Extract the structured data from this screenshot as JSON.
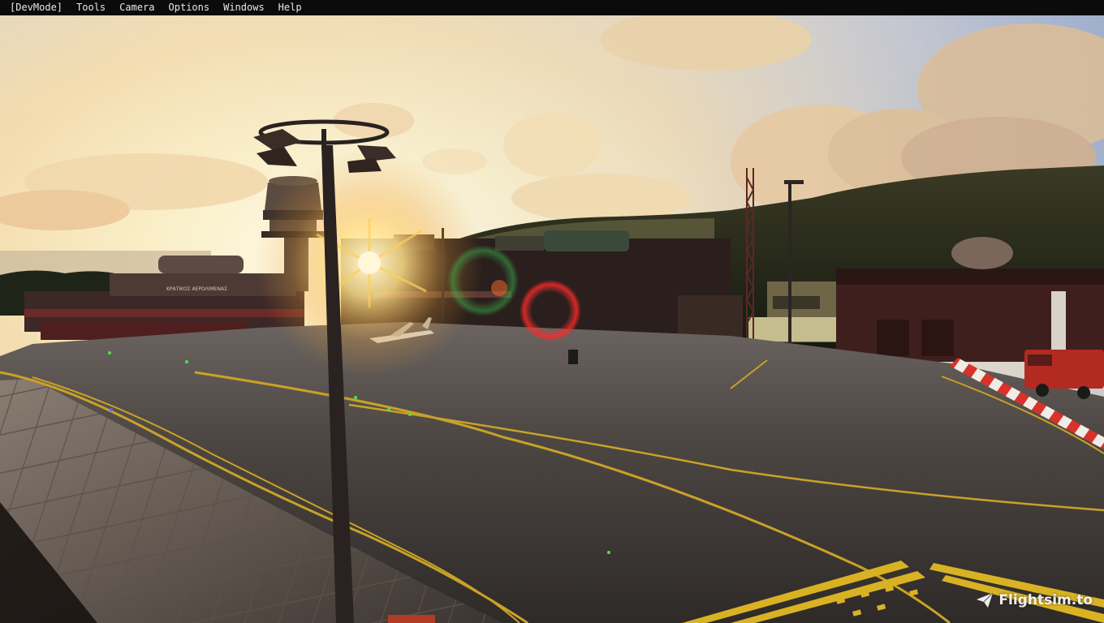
{
  "menubar": {
    "items": [
      {
        "label": "[DevMode]"
      },
      {
        "label": "Tools"
      },
      {
        "label": "Camera"
      },
      {
        "label": "Options"
      },
      {
        "label": "Windows"
      },
      {
        "label": "Help"
      }
    ]
  },
  "watermark": {
    "text": "Flightsim.to",
    "icon": "paper-plane-icon"
  },
  "scene": {
    "terminal_sign": "ΚΡΑΤΙΚΟΣ ΑΕΡΟΛΙΜΕΝΑΣ",
    "colors": {
      "sky_top": "#f6f3e6",
      "sun": "#fff7c4",
      "apron": "#4a4542",
      "taxi_line": "#c9a227",
      "barrier_red": "#d8322b"
    }
  }
}
